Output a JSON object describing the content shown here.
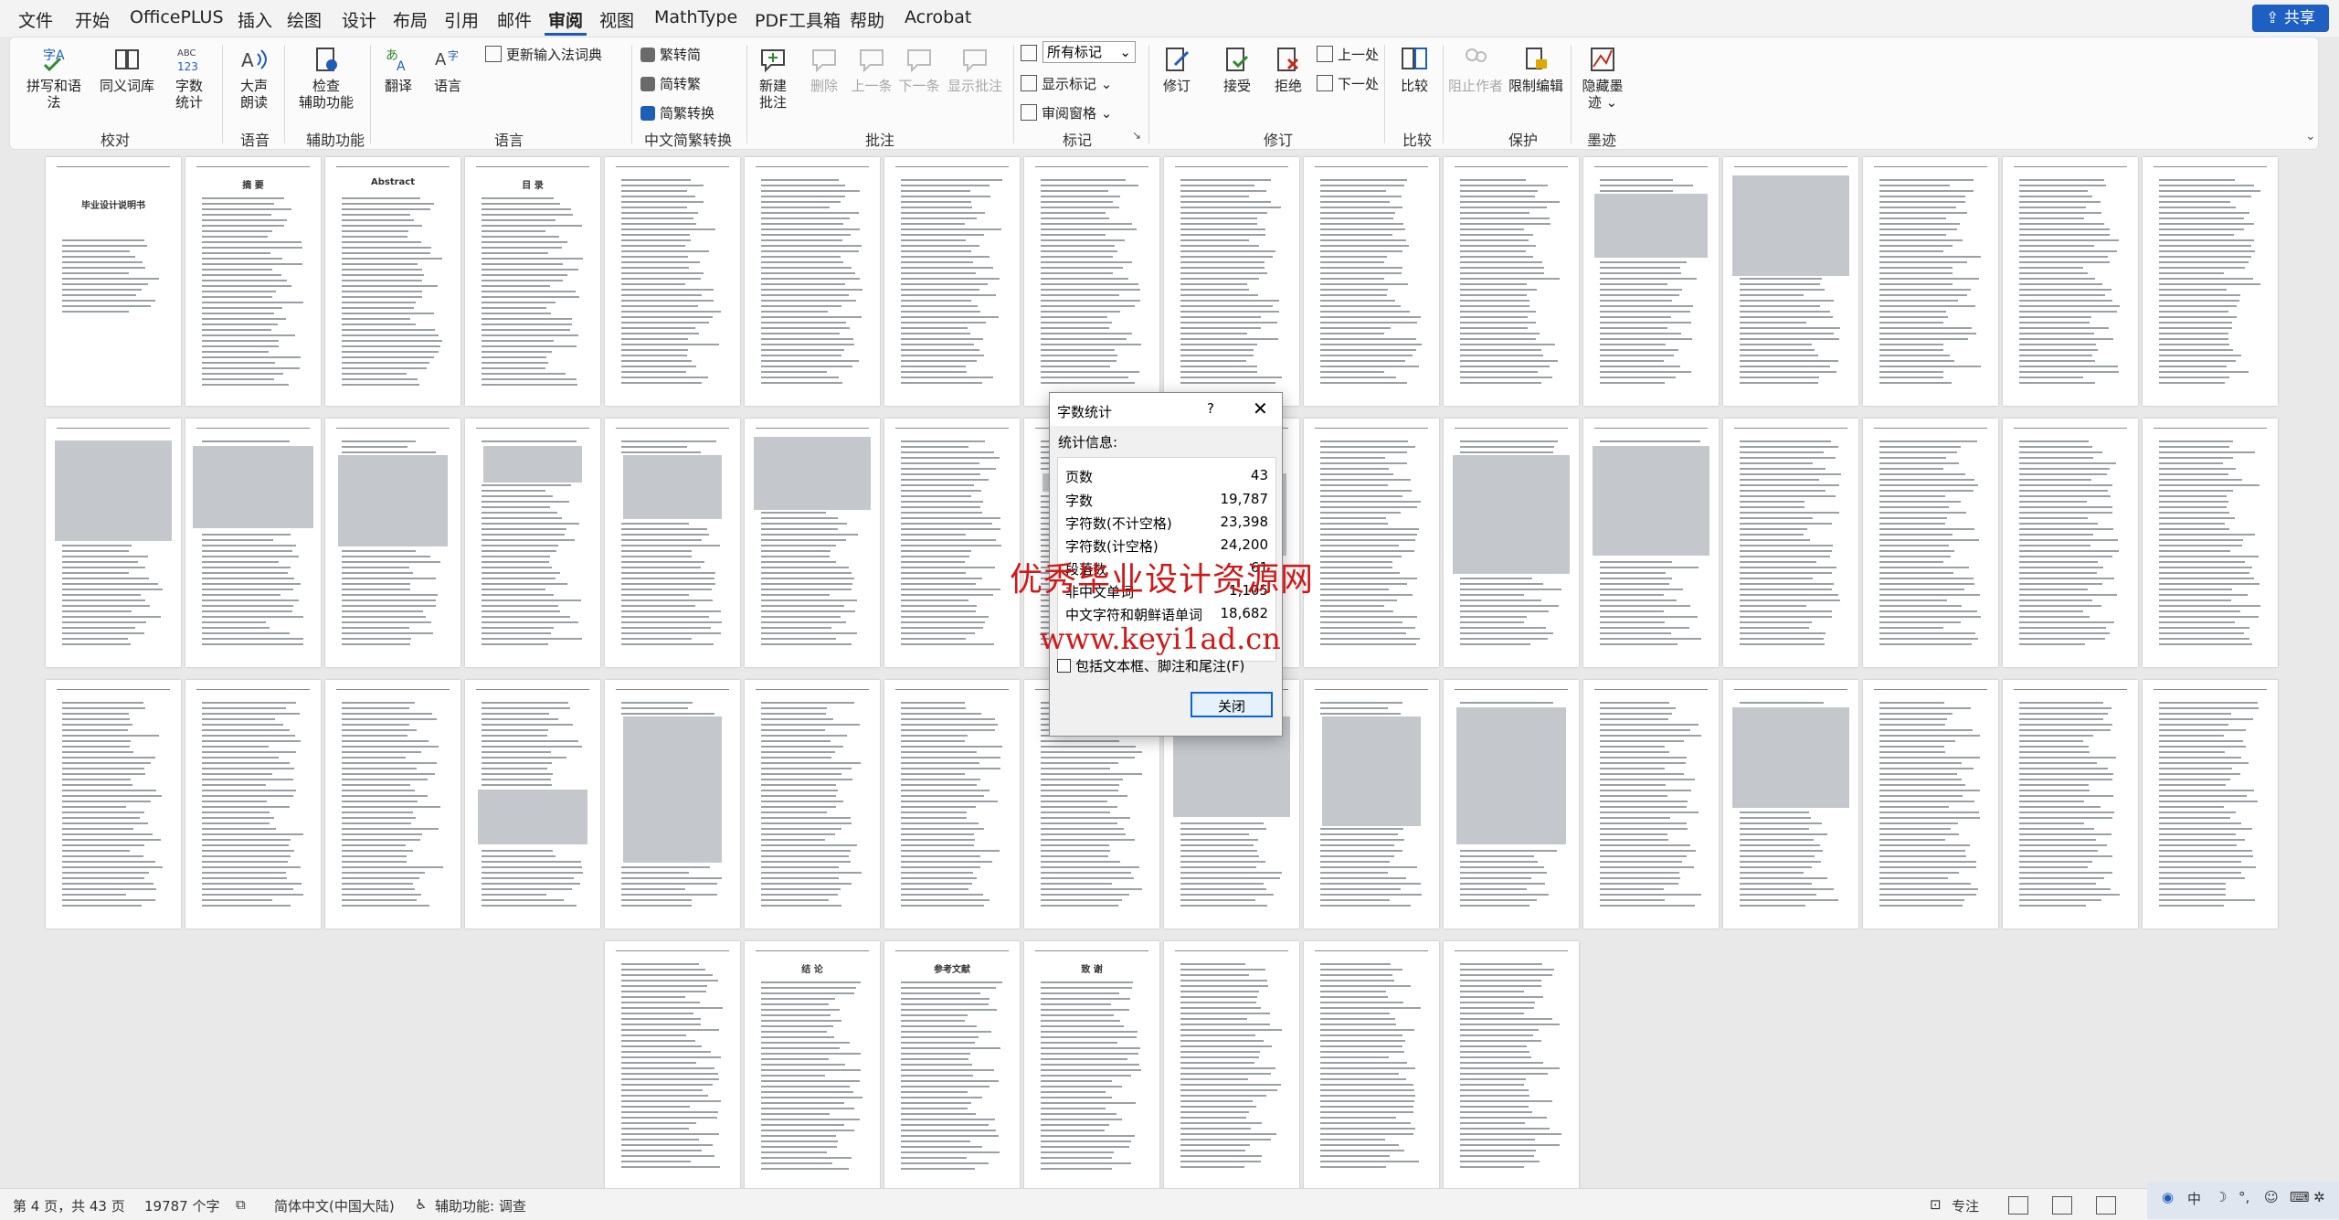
{
  "menu": {
    "tabs": [
      "文件",
      "开始",
      "OfficePLUS",
      "插入",
      "绘图",
      "设计",
      "布局",
      "引用",
      "邮件",
      "审阅",
      "视图",
      "MathType",
      "PDF工具箱",
      "帮助",
      "Acrobat"
    ],
    "active_tab": "审阅",
    "share": "共享"
  },
  "ribbon": {
    "groups": {
      "proofing": "校对",
      "speech": "语音",
      "accessibility": "辅助功能",
      "language": "语言",
      "chinese_conv": "中文简繁转换",
      "comments": "批注",
      "tracking": "标记",
      "changes": "修订",
      "compare": "比较",
      "protect": "保护",
      "ink": "墨迹"
    },
    "spell": "拼写和语法",
    "thesaurus": "同义词库",
    "wordcount_a": "字数",
    "wordcount_b": "统计",
    "readaloud_a": "大声",
    "readaloud_b": "朗读",
    "checkaccess_a": "检查",
    "checkaccess_b": "辅助功能",
    "translate": "翻译",
    "language": "语言",
    "update_ime": "更新输入法词典",
    "to_trad": "繁转简",
    "to_simp": "简转繁",
    "conv": "简繁转换",
    "new_comment_a": "新建",
    "new_comment_b": "批注",
    "delete": "删除",
    "prev": "上一条",
    "next": "下一条",
    "show_comments": "显示批注",
    "all_markup": "所有标记",
    "show_markup": "显示标记",
    "review_pane": "审阅窗格",
    "track": "修订",
    "accept": "接受",
    "reject": "拒绝",
    "prev_change": "上一处",
    "next_change": "下一处",
    "compare": "比较",
    "block_authors": "阻止作者",
    "restrict": "限制编辑",
    "hide_ink_a": "隐藏墨",
    "hide_ink_b": "迹"
  },
  "document": {
    "cover_title": "毕业设计说明书",
    "abstract_cn": "摘 要",
    "abstract_en": "Abstract",
    "toc": "目 录",
    "conclusion": "结 论",
    "references": "参考文献",
    "thanks": "致 谢"
  },
  "dialog": {
    "title": "字数统计",
    "help": "?",
    "stats_label": "统计信息:",
    "rows": [
      {
        "label": "页数",
        "value": "43"
      },
      {
        "label": "字数",
        "value": "19,787"
      },
      {
        "label": "字符数(不计空格)",
        "value": "23,398"
      },
      {
        "label": "字符数(计空格)",
        "value": "24,200"
      },
      {
        "label": "段落数",
        "value": "61"
      },
      {
        "label": "非中文单词",
        "value": "1,105"
      },
      {
        "label": "中文字符和朝鲜语单词",
        "value": "18,682"
      }
    ],
    "include_label": "包括文本框、脚注和尾注(F)",
    "close": "关闭"
  },
  "watermark": {
    "line1": "优秀毕业设计资源网",
    "line2": "www.keyi1ad.cn"
  },
  "status": {
    "page": "第 4 页，共 43 页",
    "words": "19787 个字",
    "lang": "简体中文(中国大陆)",
    "access": "辅助功能: 调查",
    "focus": "专注"
  }
}
